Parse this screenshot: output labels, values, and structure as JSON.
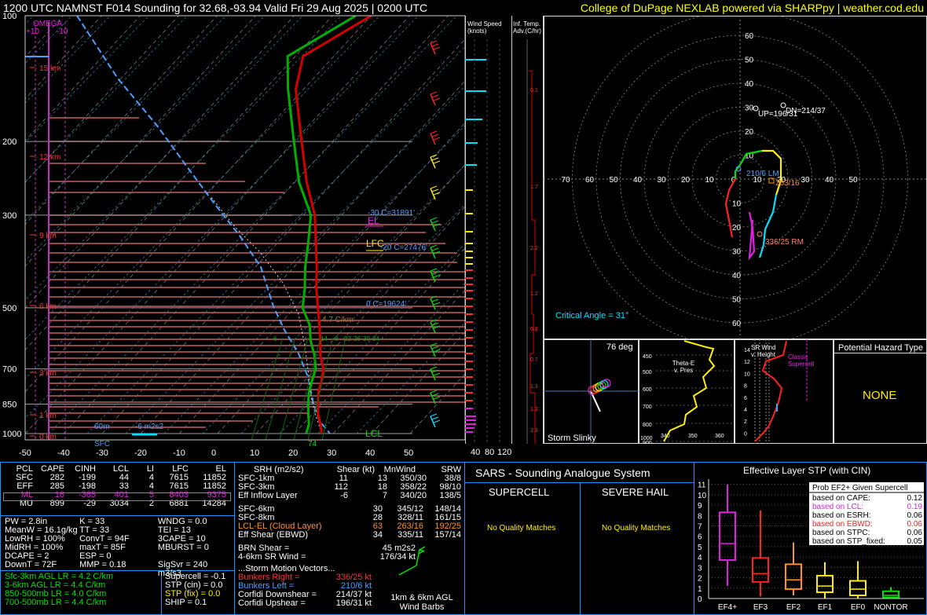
{
  "header": {
    "title": "1200 UTC NAMNST F014 Sounding for 32.68,-93.94 Valid  Fri 29 Aug 2025 | 0200 UTC",
    "credit": "College of DuPage NEXLAB powered via SHARPpy | weather.cod.edu"
  },
  "colors": {
    "temp": "#d40000",
    "dew": "#00b000",
    "wetbulb": "#4aa0ff",
    "parcel": "#ffffff",
    "hodo1": "#ff2020",
    "hodo2": "#00e000",
    "hodo3": "#ffee00",
    "hodo4": "#00e0ff",
    "hodo5": "#e020e0",
    "title": "#ffff00"
  },
  "skewt": {
    "pressure_ticks": [
      "100",
      "200",
      "300",
      "500",
      "700",
      "850",
      "1000"
    ],
    "temp_ticks": [
      "-50",
      "-40",
      "-30",
      "-20",
      "-10",
      "0",
      "10",
      "20",
      "30",
      "40",
      "50"
    ],
    "height_labels": [
      "15 km",
      "12 km",
      "9 km",
      "6 km",
      "3 km",
      "1 km",
      "0 km"
    ],
    "omega_label": "OMEGA",
    "omega_ticks": [
      "+10",
      "-10"
    ],
    "levels": [
      {
        "label": "-30 C=31891'"
      },
      {
        "label": "EL"
      },
      {
        "label": "LFC"
      },
      {
        "label": "-20 C=27476'"
      },
      {
        "label": "0 C=19624'"
      },
      {
        "label": "4.7 C/km"
      },
      {
        "label": "LCL"
      }
    ],
    "sfc_label": "SFC",
    "sfc_temp": "74",
    "eff_layer": {
      "depth": "60m",
      "srh": "-6 m2s2"
    },
    "lapse_labels": [
      "6",
      "14",
      "8",
      "22",
      "26",
      "30",
      "34"
    ],
    "temp_profile": [
      [
        1000,
        27
      ],
      [
        950,
        24.5
      ],
      [
        900,
        21.5
      ],
      [
        850,
        19
      ],
      [
        800,
        16.5
      ],
      [
        750,
        14.5
      ],
      [
        700,
        12
      ],
      [
        650,
        8
      ],
      [
        600,
        4.5
      ],
      [
        550,
        0.5
      ],
      [
        500,
        -4
      ],
      [
        450,
        -9
      ],
      [
        400,
        -14
      ],
      [
        350,
        -20
      ],
      [
        300,
        -27
      ],
      [
        250,
        -37
      ],
      [
        200,
        -48
      ],
      [
        150,
        -62
      ],
      [
        125,
        -68
      ],
      [
        100,
        -60
      ]
    ],
    "dew_profile": [
      [
        1000,
        23
      ],
      [
        950,
        21.5
      ],
      [
        900,
        19
      ],
      [
        850,
        16.5
      ],
      [
        800,
        14
      ],
      [
        750,
        12
      ],
      [
        700,
        10
      ],
      [
        650,
        6.5
      ],
      [
        600,
        2
      ],
      [
        550,
        -2
      ],
      [
        500,
        -8
      ],
      [
        450,
        -12
      ],
      [
        400,
        -17
      ],
      [
        350,
        -22
      ],
      [
        300,
        -28
      ],
      [
        250,
        -39
      ],
      [
        200,
        -50
      ],
      [
        150,
        -64
      ],
      [
        125,
        -72
      ],
      [
        100,
        -64
      ]
    ]
  },
  "wind_panel": {
    "title": "Wind Speed (knots)",
    "ticks": [
      "40",
      "80",
      "120"
    ]
  },
  "adv_panel": {
    "title": "Inf. Temp. Adv.(C/hr)",
    "values": [
      "0.1",
      "1.7",
      "2.2",
      "1.2",
      "0.8",
      "0.7",
      "1.3",
      "1.3",
      "3.3"
    ]
  },
  "hodograph": {
    "ring_labels": [
      "60",
      "50",
      "40",
      "30",
      "20",
      "10"
    ],
    "x_labels": [
      "70",
      "60",
      "50",
      "40",
      "30",
      "20",
      "10",
      "0",
      "10",
      "20",
      "30",
      "40",
      "50"
    ],
    "y_labels_up": [
      "60",
      "50",
      "40",
      "30",
      "20",
      "10"
    ],
    "y_labels_down": [
      "10",
      "20",
      "30",
      "40",
      "50",
      "60"
    ],
    "up_label": "UP=196/31",
    "dn_label": "DN=214/37",
    "lm_label": "210/6 LM",
    "rm_label": "336/25 RM",
    "mean_label": "263/16",
    "critical_angle": "Critical Angle = 31°"
  },
  "slinky": {
    "title": "76 deg",
    "label": "Storm Slinky"
  },
  "theta": {
    "label": "Theta-E v. Pres",
    "ticks": [
      "450",
      "500",
      "600",
      "700",
      "800",
      "900",
      "1000"
    ],
    "xticks": [
      "340",
      "350",
      "360"
    ]
  },
  "srwind": {
    "title": "SR Wind v. Height",
    "classic": "Classic Supercell",
    "yticks": [
      "14",
      "12",
      "10",
      "8",
      "6",
      "4",
      "2",
      "0"
    ]
  },
  "hazard": {
    "title": "Potential Hazard Type",
    "value": "NONE"
  },
  "parcels": {
    "headers": [
      "PCL",
      "CAPE",
      "CINH",
      "LCL",
      "LI",
      "LFC",
      "EL"
    ],
    "rows": [
      [
        "SFC",
        "282",
        "-199",
        "44",
        "4",
        "7615",
        "11852"
      ],
      [
        "EFF",
        "285",
        "-198",
        "33",
        "4",
        "7615",
        "11852"
      ],
      [
        "ML",
        "16",
        "-365",
        "401",
        "5",
        "8403",
        "9375"
      ],
      [
        "MU",
        "899",
        "-29",
        "3034",
        "2",
        "6881",
        "14284"
      ]
    ]
  },
  "indices": [
    [
      "PW = 2.8in",
      "K = 33",
      "WNDG = 0.0"
    ],
    [
      "MeanW = 16.1g/kg",
      "TT = 33",
      "TEI = 13"
    ],
    [
      "LowRH = 100%",
      "ConvT = 94F",
      "3CAPE = 10"
    ],
    [
      "MidRH = 100%",
      "maxT = 85F",
      "MBURST = 0"
    ],
    [
      "DCAPE = 2",
      "ESP = 0",
      ""
    ],
    [
      "DownT = 72F",
      "MMP = 0.18",
      "SigSvr = 240 m3/s3"
    ]
  ],
  "lapse": [
    "Sfc-3km AGL LR = 4.2 C/km",
    "3-6km AGL LR = 4.4 C/km",
    "850-500mb LR = 4.0 C/km",
    "700-500mb LR = 4.4 C/km"
  ],
  "composites": [
    "Supercell = -0.1",
    "STP (cin) = 0.0",
    "STP (fix) = 0.0",
    "SHIP = 0.1"
  ],
  "kinematics": {
    "headers": [
      "SRH (m2/s2)",
      "Shear (kt)",
      "MnWind",
      "SRW"
    ],
    "rows": [
      [
        "SFC-1km",
        "11",
        "13",
        "350/30",
        "38/8"
      ],
      [
        "SFC-3km",
        "112",
        "18",
        "358/22",
        "98/10"
      ],
      [
        "Eff Inflow Layer",
        "-6",
        "7",
        "340/20",
        "138/5"
      ],
      [
        "SFC-6km",
        "30",
        "345/12",
        "148/14",
        ""
      ],
      [
        "SFC-8km",
        "28",
        "328/11",
        "161/15",
        ""
      ],
      [
        "LCL-EL (Cloud Layer)",
        "63",
        "263/16",
        "192/25",
        ""
      ],
      [
        "Eff Shear (EBWD)",
        "34",
        "335/11",
        "157/14",
        ""
      ]
    ],
    "brn": [
      "BRN Shear =",
      "45 m2s2"
    ],
    "sr46": [
      "4-6km SR Wind =",
      "176/34 kt"
    ],
    "storm_motion": "...Storm Motion Vectors...",
    "vectors": [
      [
        "Bunkers Right =",
        "336/25 kt"
      ],
      [
        "Bunkers Left =",
        "210/6 kt"
      ],
      [
        "Corfidi Downshear =",
        "214/37 kt"
      ],
      [
        "Corfidi Upshear =",
        "196/31 kt"
      ]
    ],
    "barbs_label": "1km & 6km AGL Wind Barbs"
  },
  "sars": {
    "title": "SARS - Sounding Analogue System",
    "supercell": "SUPERCELL",
    "hail": "SEVERE HAIL",
    "supercell_result": "No Quality Matches",
    "hail_result": "No Quality Matches"
  },
  "chart_data": {
    "type": "box",
    "title": "Effective Layer STP (with CIN)",
    "categories": [
      "EF4+",
      "EF3",
      "EF2",
      "EF1",
      "EF0",
      "NONTOR"
    ],
    "y_ticks": [
      0,
      1,
      2,
      3,
      4,
      5,
      6,
      7,
      8,
      9,
      10,
      11
    ],
    "ylim": [
      0,
      11.5
    ],
    "boxes": [
      {
        "name": "EF4+",
        "min": 1.2,
        "q1": 3.7,
        "median": 5.3,
        "q3": 8.3,
        "max": 11,
        "color": "#e020e0"
      },
      {
        "name": "EF3",
        "min": 0.2,
        "q1": 1.6,
        "median": 2.4,
        "q3": 3.9,
        "max": 8.5,
        "color": "#ff2020"
      },
      {
        "name": "EF2",
        "min": 0.3,
        "q1": 0.9,
        "median": 1.8,
        "q3": 3.3,
        "max": 5.4,
        "color": "#ff9020"
      },
      {
        "name": "EF1",
        "min": 0,
        "q1": 0.6,
        "median": 1.2,
        "q3": 2.2,
        "max": 3.5,
        "color": "#ffee00"
      },
      {
        "name": "EF0",
        "min": 0,
        "q1": 0.3,
        "median": 0.9,
        "q3": 1.7,
        "max": 3.6,
        "color": "#ffee00"
      },
      {
        "name": "NONTOR",
        "min": 0,
        "q1": 0.1,
        "median": 0.3,
        "q3": 0.7,
        "max": 1.1,
        "color": "#00e000"
      }
    ],
    "legend_title": "Prob EF2+ Given Supercell",
    "legend": [
      {
        "label": "based on CAPE:",
        "value": "0.12",
        "color": "#000000"
      },
      {
        "label": "based on LCL:",
        "value": "0.19",
        "color": "#e020e0"
      },
      {
        "label": "based on ESRH:",
        "value": "0.06",
        "color": "#000000"
      },
      {
        "label": "based on EBWD:",
        "value": "0.06",
        "color": "#ff2020"
      },
      {
        "label": "based on STPC:",
        "value": "0.06",
        "color": "#000000"
      },
      {
        "label": "based on STP_fixed:",
        "value": "0.05",
        "color": "#000000"
      }
    ]
  }
}
